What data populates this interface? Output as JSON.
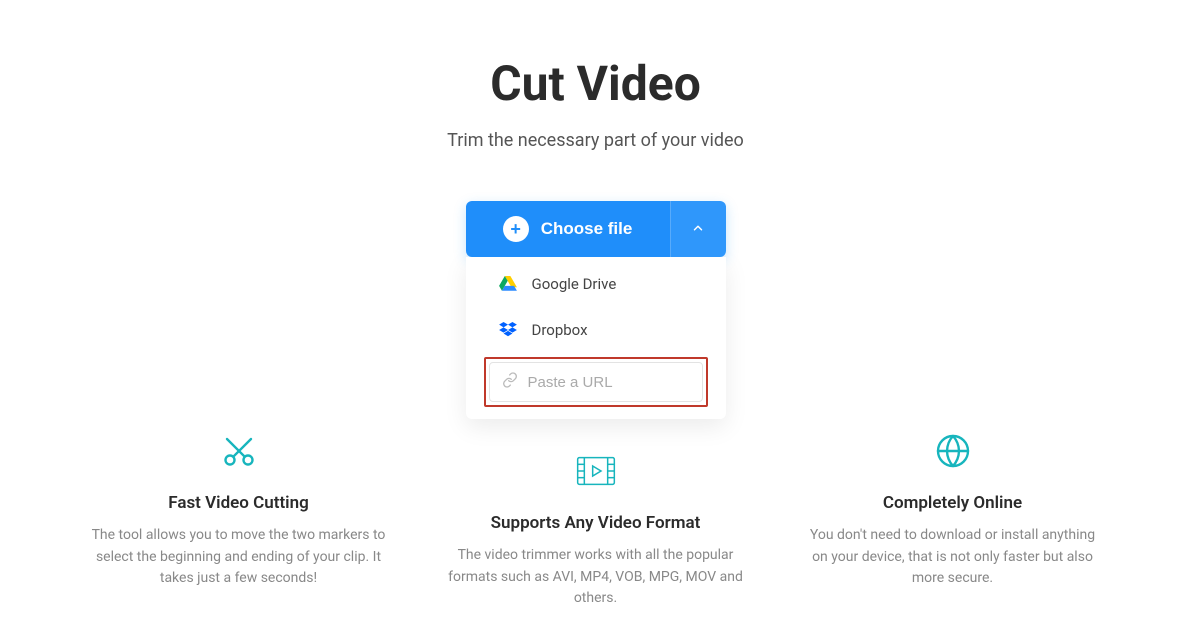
{
  "header": {
    "title": "Cut Video",
    "subtitle": "Trim the necessary part of your video"
  },
  "upload": {
    "choose_label": "Choose file",
    "options": {
      "google_drive": "Google Drive",
      "dropbox": "Dropbox"
    },
    "url_placeholder": "Paste a URL"
  },
  "features": [
    {
      "title": "Fast Video Cutting",
      "desc": "The tool allows you to move the two markers to select the beginning and ending of your clip. It takes just a few seconds!"
    },
    {
      "title": "Supports Any Video Format",
      "desc": "The video trimmer works with all the popular formats such as AVI, MP4, VOB, MPG, MOV and others."
    },
    {
      "title": "Completely Online",
      "desc": "You don't need to download or install anything on your device, that is not only faster but also more secure."
    }
  ]
}
